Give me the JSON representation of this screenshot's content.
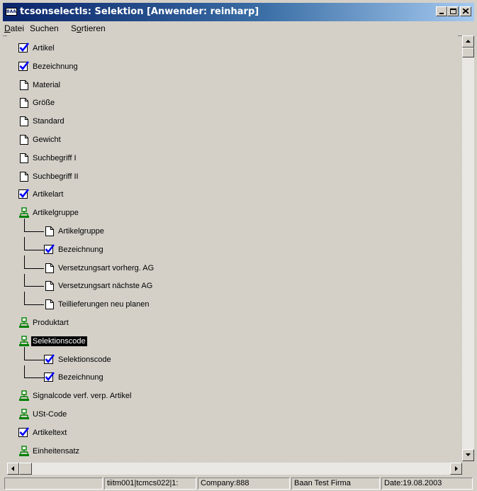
{
  "window": {
    "title": "tcsonselectls: Selektion [Anwender: reinharp]",
    "app_icon_text": "BAAN"
  },
  "menu": [
    {
      "prefix": "",
      "underline": "D",
      "suffix": "atei"
    },
    {
      "prefix": "Suchen",
      "underline": "",
      "suffix": ""
    },
    {
      "prefix": "S",
      "underline": "o",
      "suffix": "rtieren"
    }
  ],
  "tree": [
    {
      "label": "Artikel",
      "icon": "checked-checkbox-icon",
      "level": 0,
      "selected": false
    },
    {
      "label": "Bezeichnung",
      "icon": "checked-checkbox-icon",
      "level": 0,
      "selected": false
    },
    {
      "label": "Material",
      "icon": "document-icon",
      "level": 0,
      "selected": false
    },
    {
      "label": "Größe",
      "icon": "document-icon",
      "level": 0,
      "selected": false
    },
    {
      "label": "Standard",
      "icon": "document-icon",
      "level": 0,
      "selected": false
    },
    {
      "label": "Gewicht",
      "icon": "document-icon",
      "level": 0,
      "selected": false
    },
    {
      "label": "Suchbegriff I",
      "icon": "document-icon",
      "level": 0,
      "selected": false
    },
    {
      "label": "Suchbegriff II",
      "icon": "document-icon",
      "level": 0,
      "selected": false
    },
    {
      "label": "Artikelart",
      "icon": "checked-checkbox-icon",
      "level": 0,
      "selected": false
    },
    {
      "label": "Artikelgruppe",
      "icon": "hierarchy-icon",
      "level": 0,
      "selected": false
    },
    {
      "label": "Artikelgruppe",
      "icon": "document-icon",
      "level": 1,
      "selected": false
    },
    {
      "label": "Bezeichnung",
      "icon": "checked-checkbox-icon",
      "level": 1,
      "selected": false
    },
    {
      "label": "Versetzungsart vorherg. AG",
      "icon": "document-icon",
      "level": 1,
      "selected": false
    },
    {
      "label": "Versetzungsart nächste AG",
      "icon": "document-icon",
      "level": 1,
      "selected": false
    },
    {
      "label": "Teillieferungen neu planen",
      "icon": "document-icon",
      "level": 1,
      "selected": false
    },
    {
      "label": "Produktart",
      "icon": "hierarchy-icon",
      "level": 0,
      "selected": false
    },
    {
      "label": "Selektionscode",
      "icon": "hierarchy-icon",
      "level": 0,
      "selected": true
    },
    {
      "label": "Selektionscode",
      "icon": "checked-checkbox-icon",
      "level": 1,
      "selected": false
    },
    {
      "label": "Bezeichnung",
      "icon": "checked-checkbox-icon",
      "level": 1,
      "selected": false
    },
    {
      "label": "Signalcode verf. verp. Artikel",
      "icon": "hierarchy-icon",
      "level": 0,
      "selected": false
    },
    {
      "label": "USt-Code",
      "icon": "hierarchy-icon",
      "level": 0,
      "selected": false
    },
    {
      "label": "Artikeltext",
      "icon": "checked-checkbox-icon",
      "level": 0,
      "selected": false
    },
    {
      "label": "Einheitensatz",
      "icon": "hierarchy-icon",
      "level": 0,
      "selected": false
    }
  ],
  "status": {
    "session": "tiitm001|tcmcs022|1:",
    "company": "Company:888",
    "firm": "Baan Test Firma",
    "date": "Date:19.08.2003"
  },
  "colors": {
    "title_start": "#0a246a",
    "title_end": "#a6caf0",
    "face": "#d4d0c8",
    "check": "#0000ff"
  }
}
